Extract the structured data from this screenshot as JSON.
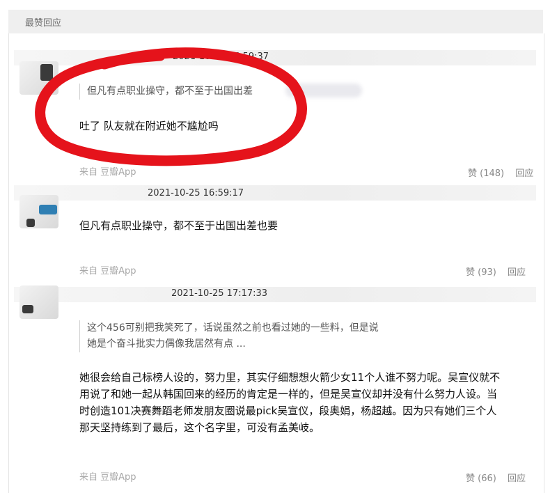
{
  "section": {
    "title": "最赞回应"
  },
  "comments": [
    {
      "timestamp": "2021-10-25 16:59:37",
      "quote": [
        "但凡有点职业操守，都不至于出国出差"
      ],
      "text": [
        "吐了 队友就在附近她不尴尬吗"
      ],
      "source": "来自 豆瓣App",
      "likes": "赞 (148)",
      "reply": "回应"
    },
    {
      "timestamp": "2021-10-25 16:59:17",
      "quote": [],
      "text": [
        "但凡有点职业操守，都不至于出国出差也要"
      ],
      "source": "来自 豆瓣App",
      "likes": "赞 (93)",
      "reply": "回应"
    },
    {
      "timestamp": "2021-10-25 17:17:33",
      "quote": [
        "这个456可别把我笑死了，话说虽然之前也看过她的一些料，但是说",
        "她是个奋斗批实力偶像我居然有点 ..."
      ],
      "text": [
        "她很会给自己标榜人设的，努力里，其实仔细想想火箭少女11个人谁不努力呢。吴宣仪就不",
        "用说了和她一起从韩国回来的经历的肯定是一样的，但是吴宣仪却并没有什么努力人设。当",
        "时创造101决赛舞蹈老师发朋友圈说最pick吴宣仪，段奥娟，杨超越。因为只有她们三个人",
        "那天坚持练到了最后，这个名字里，可没有孟美岐。"
      ],
      "source": "来自 豆瓣App",
      "likes": "赞 (66)",
      "reply": "回应"
    }
  ],
  "annotation": {
    "color": "#e5131b",
    "shape": "hand-drawn-circle"
  }
}
